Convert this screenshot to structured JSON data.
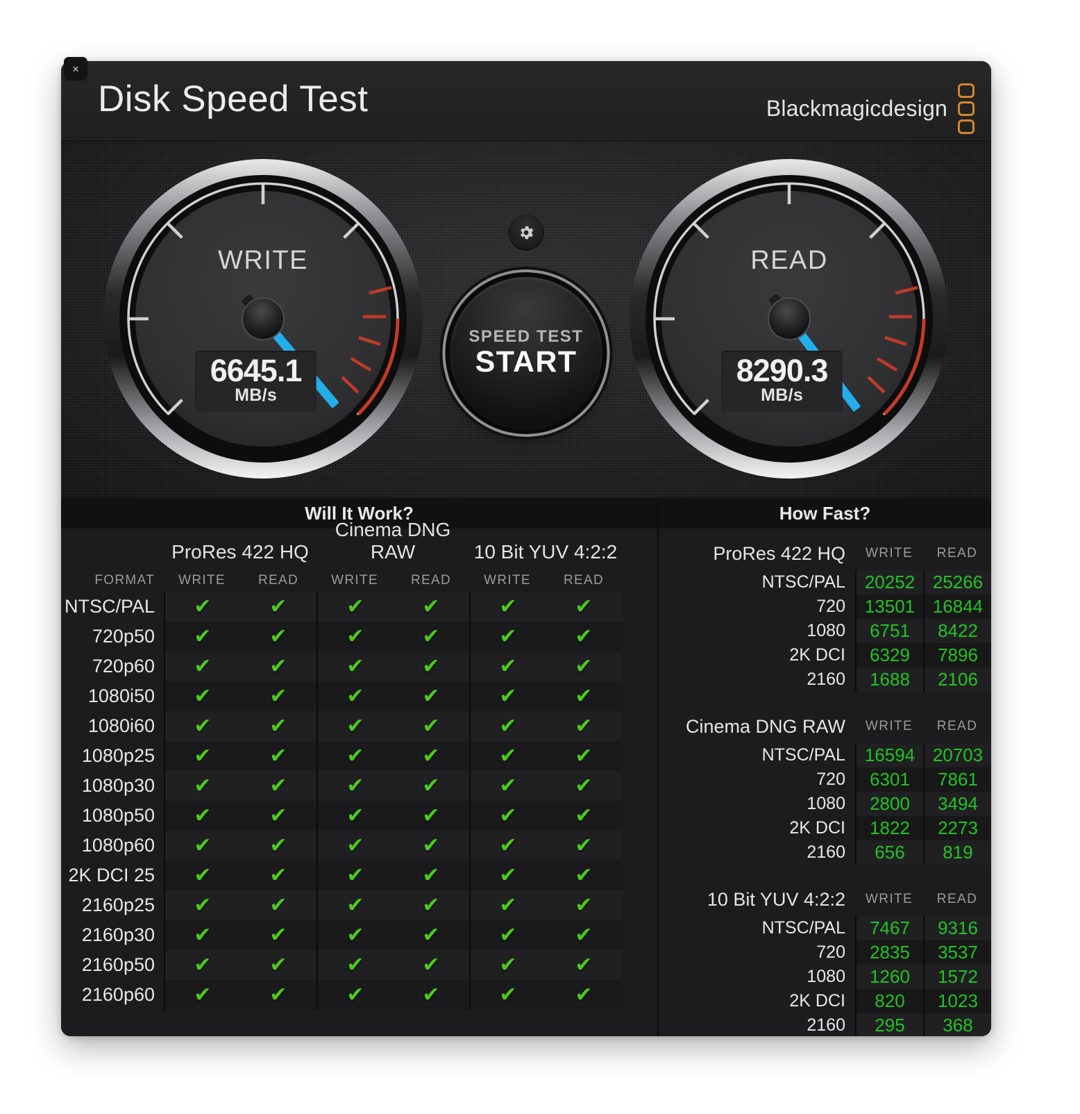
{
  "window": {
    "title": "Disk Speed Test",
    "close_label": "×",
    "brand_text": "Blackmagicdesign",
    "brand_accent": "#d4872b"
  },
  "gauges": {
    "needle_color": "#22aee8",
    "redzone_color": "#c23b28",
    "write": {
      "label": "WRITE",
      "value": "6645.1",
      "unit": "MB/s",
      "angle_deg": 140
    },
    "read": {
      "label": "READ",
      "value": "8290.3",
      "unit": "MB/s",
      "angle_deg": 143
    }
  },
  "controls": {
    "gear_icon": "gear-icon",
    "start_line1": "SPEED TEST",
    "start_line2": "START"
  },
  "will_it_work": {
    "title": "Will It Work?",
    "format_header": "FORMAT",
    "groups": [
      "ProRes 422 HQ",
      "Cinema DNG RAW",
      "10 Bit YUV 4:2:2"
    ],
    "subheaders": [
      "WRITE",
      "READ"
    ],
    "check_glyph": "✔",
    "check_color": "#4cc91e",
    "rows": [
      {
        "format": "NTSC/PAL",
        "cells": [
          true,
          true,
          true,
          true,
          true,
          true
        ]
      },
      {
        "format": "720p50",
        "cells": [
          true,
          true,
          true,
          true,
          true,
          true
        ]
      },
      {
        "format": "720p60",
        "cells": [
          true,
          true,
          true,
          true,
          true,
          true
        ]
      },
      {
        "format": "1080i50",
        "cells": [
          true,
          true,
          true,
          true,
          true,
          true
        ]
      },
      {
        "format": "1080i60",
        "cells": [
          true,
          true,
          true,
          true,
          true,
          true
        ]
      },
      {
        "format": "1080p25",
        "cells": [
          true,
          true,
          true,
          true,
          true,
          true
        ]
      },
      {
        "format": "1080p30",
        "cells": [
          true,
          true,
          true,
          true,
          true,
          true
        ]
      },
      {
        "format": "1080p50",
        "cells": [
          true,
          true,
          true,
          true,
          true,
          true
        ]
      },
      {
        "format": "1080p60",
        "cells": [
          true,
          true,
          true,
          true,
          true,
          true
        ]
      },
      {
        "format": "2K DCI 25",
        "cells": [
          true,
          true,
          true,
          true,
          true,
          true
        ]
      },
      {
        "format": "2160p25",
        "cells": [
          true,
          true,
          true,
          true,
          true,
          true
        ]
      },
      {
        "format": "2160p30",
        "cells": [
          true,
          true,
          true,
          true,
          true,
          true
        ]
      },
      {
        "format": "2160p50",
        "cells": [
          true,
          true,
          true,
          true,
          true,
          true
        ]
      },
      {
        "format": "2160p60",
        "cells": [
          true,
          true,
          true,
          true,
          true,
          true
        ]
      }
    ]
  },
  "how_fast": {
    "title": "How Fast?",
    "col_write": "WRITE",
    "col_read": "READ",
    "value_color": "#22c322",
    "sections": [
      {
        "name": "ProRes 422 HQ",
        "rows": [
          {
            "format": "NTSC/PAL",
            "write": "20252",
            "read": "25266"
          },
          {
            "format": "720",
            "write": "13501",
            "read": "16844"
          },
          {
            "format": "1080",
            "write": "6751",
            "read": "8422"
          },
          {
            "format": "2K DCI",
            "write": "6329",
            "read": "7896"
          },
          {
            "format": "2160",
            "write": "1688",
            "read": "2106"
          }
        ]
      },
      {
        "name": "Cinema DNG RAW",
        "rows": [
          {
            "format": "NTSC/PAL",
            "write": "16594",
            "read": "20703"
          },
          {
            "format": "720",
            "write": "6301",
            "read": "7861"
          },
          {
            "format": "1080",
            "write": "2800",
            "read": "3494"
          },
          {
            "format": "2K DCI",
            "write": "1822",
            "read": "2273"
          },
          {
            "format": "2160",
            "write": "656",
            "read": "819"
          }
        ]
      },
      {
        "name": "10 Bit YUV 4:2:2",
        "rows": [
          {
            "format": "NTSC/PAL",
            "write": "7467",
            "read": "9316"
          },
          {
            "format": "720",
            "write": "2835",
            "read": "3537"
          },
          {
            "format": "1080",
            "write": "1260",
            "read": "1572"
          },
          {
            "format": "2K DCI",
            "write": "820",
            "read": "1023"
          },
          {
            "format": "2160",
            "write": "295",
            "read": "368"
          }
        ]
      }
    ]
  }
}
